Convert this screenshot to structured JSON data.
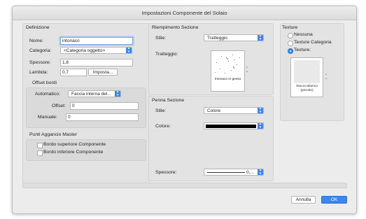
{
  "window": {
    "title": "Impostazioni Componente del Solaio"
  },
  "definizione": {
    "header": "Definizione",
    "nome_label": "Nome:",
    "nome_value": "intonaco",
    "categoria_label": "Categoria:",
    "categoria_value": "<Categoria oggetto>",
    "spessore_label": "Spessore:",
    "spessore_value": "1,8",
    "lambda_label": "Lambda:",
    "lambda_value": "0,7",
    "imposta_button": "Imposta...",
    "offset_header": "Offset bordi",
    "automatico_label": "Automatico:",
    "automatico_value": "Faccia interna del...",
    "offset_label": "Offset:",
    "offset_value": "0",
    "manuale_label": "Manuale:",
    "manuale_value": "0",
    "punti_header": "Punti Aggancio Master",
    "bordo_superiore": "Bordo superiore Componente",
    "bordo_inferiore": "Bordo inferiore Componente"
  },
  "riempimento": {
    "header": "Riempimento Sezione",
    "stile_label": "Stile:",
    "stile_value": "Tratteggio",
    "tratteggio_label": "Tratteggio:",
    "swatch_caption": "Intonaco in gesso"
  },
  "penna": {
    "header": "Penna Sezione",
    "stile_label": "Stile:",
    "stile_value": "Colore",
    "colore_label": "Colore:",
    "colore_hex": "#000000",
    "spessore_label": "Spessore:",
    "spessore_value": "0,..."
  },
  "texture": {
    "header": "Texture",
    "nessuna": "Nessuna",
    "texture_categoria": "Texture Categoria",
    "texture": "Texture:",
    "selected": "texture",
    "swatch_caption": "Stucco Bianco (piccolo)"
  },
  "footer": {
    "annulla": "Annulla",
    "ok": "OK",
    "accent": "#3b86f0"
  }
}
